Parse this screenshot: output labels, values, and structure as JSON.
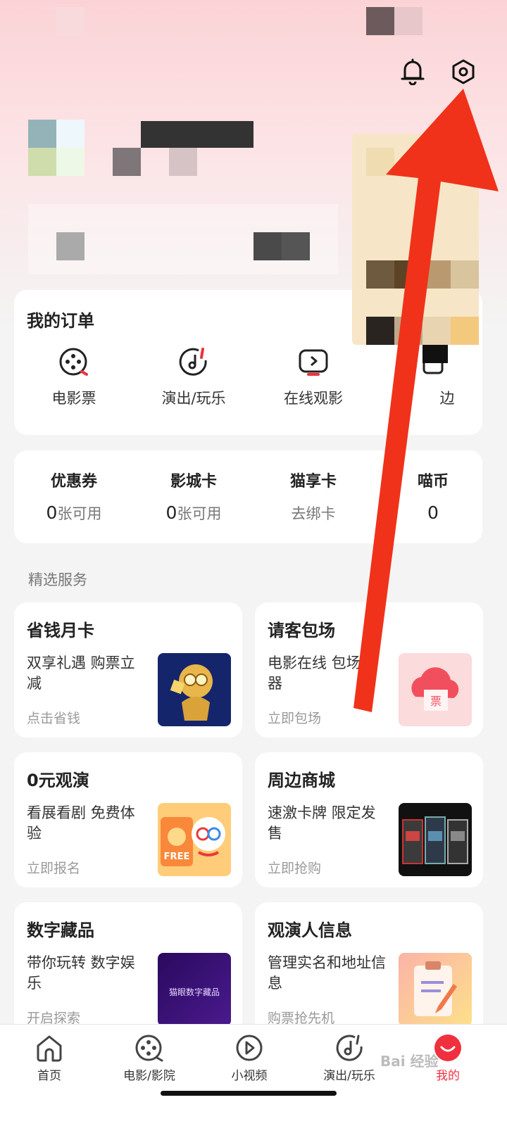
{
  "header": {
    "bell_icon": "bell-icon",
    "settings_icon": "settings-hexagon-icon"
  },
  "orders": {
    "title": "我的订单",
    "items": [
      {
        "label": "电影票",
        "icon": "film-reel-icon"
      },
      {
        "label": "演出/玩乐",
        "icon": "music-note-icon"
      },
      {
        "label": "在线观影",
        "icon": "play-screen-icon"
      },
      {
        "label": "边",
        "icon": "bag-icon"
      }
    ]
  },
  "assets": [
    {
      "title": "优惠券",
      "count": "0",
      "unit": "张可用"
    },
    {
      "title": "影城卡",
      "count": "0",
      "unit": "张可用"
    },
    {
      "title": "猫享卡",
      "count": "",
      "unit": "去绑卡"
    },
    {
      "title": "喵币",
      "count": "0",
      "unit": ""
    }
  ],
  "services": {
    "label": "精选服务",
    "cards": [
      {
        "title": "省钱月卡",
        "desc": "双享礼遇 购票立减",
        "action": "点击省钱"
      },
      {
        "title": "请客包场",
        "desc": "电影在线 包场神器",
        "action": "立即包场"
      },
      {
        "title": "0元观演",
        "desc": "看展看剧 免费体验",
        "action": "立即报名"
      },
      {
        "title": "周边商城",
        "desc": "速激卡牌 限定发售",
        "action": "立即抢购"
      },
      {
        "title": "数字藏品",
        "desc": "带你玩转 数字娱乐",
        "action": "开启探索"
      },
      {
        "title": "观演人信息",
        "desc": "管理实名和地址信息",
        "action": "购票抢先机"
      }
    ],
    "img_text": {
      "ticket": "票",
      "free": "FREE",
      "digital": "猫眼数字藏品"
    }
  },
  "tabbar": [
    {
      "label": "首页",
      "icon": "home-icon"
    },
    {
      "label": "电影/影院",
      "icon": "film-reel-icon"
    },
    {
      "label": "小视频",
      "icon": "play-circle-icon"
    },
    {
      "label": "演出/玩乐",
      "icon": "music-note-icon"
    },
    {
      "label": "我的",
      "icon": "profile-smile-icon"
    }
  ],
  "watermark": "Bai 经验",
  "colors": {
    "accent": "#f0303f",
    "annotation_arrow": "#f0321a"
  }
}
